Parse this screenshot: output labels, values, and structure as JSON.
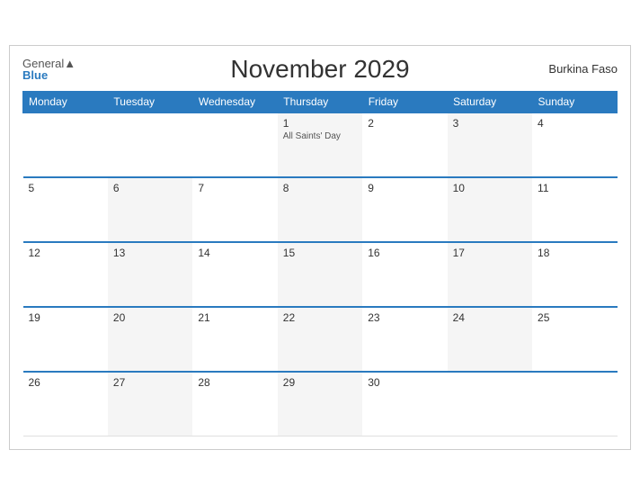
{
  "header": {
    "logo_general": "General",
    "logo_blue": "Blue",
    "title": "November 2029",
    "country": "Burkina Faso"
  },
  "weekdays": [
    "Monday",
    "Tuesday",
    "Wednesday",
    "Thursday",
    "Friday",
    "Saturday",
    "Sunday"
  ],
  "weeks": [
    [
      {
        "day": "",
        "holiday": ""
      },
      {
        "day": "",
        "holiday": ""
      },
      {
        "day": "",
        "holiday": ""
      },
      {
        "day": "1",
        "holiday": "All Saints' Day"
      },
      {
        "day": "2",
        "holiday": ""
      },
      {
        "day": "3",
        "holiday": ""
      },
      {
        "day": "4",
        "holiday": ""
      }
    ],
    [
      {
        "day": "5",
        "holiday": ""
      },
      {
        "day": "6",
        "holiday": ""
      },
      {
        "day": "7",
        "holiday": ""
      },
      {
        "day": "8",
        "holiday": ""
      },
      {
        "day": "9",
        "holiday": ""
      },
      {
        "day": "10",
        "holiday": ""
      },
      {
        "day": "11",
        "holiday": ""
      }
    ],
    [
      {
        "day": "12",
        "holiday": ""
      },
      {
        "day": "13",
        "holiday": ""
      },
      {
        "day": "14",
        "holiday": ""
      },
      {
        "day": "15",
        "holiday": ""
      },
      {
        "day": "16",
        "holiday": ""
      },
      {
        "day": "17",
        "holiday": ""
      },
      {
        "day": "18",
        "holiday": ""
      }
    ],
    [
      {
        "day": "19",
        "holiday": ""
      },
      {
        "day": "20",
        "holiday": ""
      },
      {
        "day": "21",
        "holiday": ""
      },
      {
        "day": "22",
        "holiday": ""
      },
      {
        "day": "23",
        "holiday": ""
      },
      {
        "day": "24",
        "holiday": ""
      },
      {
        "day": "25",
        "holiday": ""
      }
    ],
    [
      {
        "day": "26",
        "holiday": ""
      },
      {
        "day": "27",
        "holiday": ""
      },
      {
        "day": "28",
        "holiday": ""
      },
      {
        "day": "29",
        "holiday": ""
      },
      {
        "day": "30",
        "holiday": ""
      },
      {
        "day": "",
        "holiday": ""
      },
      {
        "day": "",
        "holiday": ""
      }
    ]
  ]
}
